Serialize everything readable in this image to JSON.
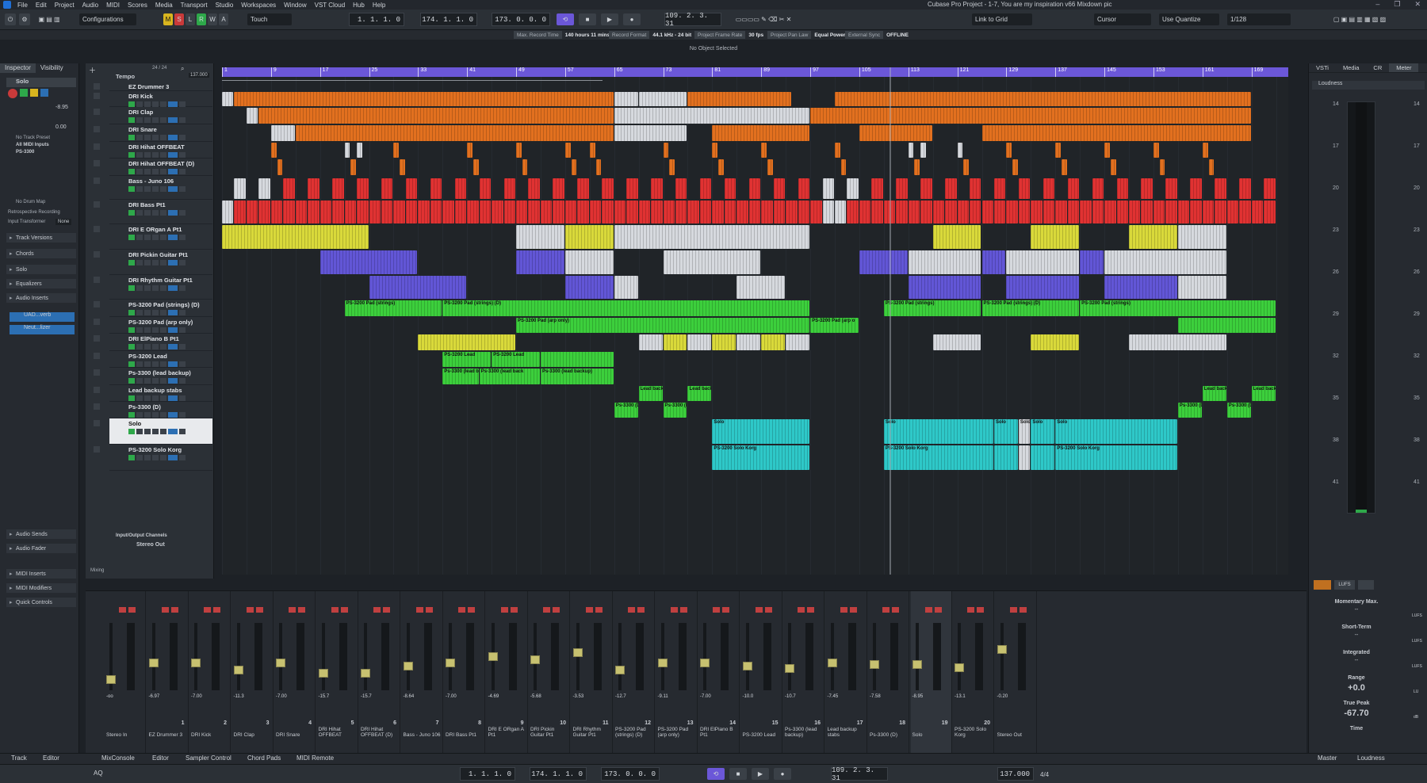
{
  "window": {
    "title": "Cubase Pro Project - 1-7, You are my inspiration v66 Mixdown pic",
    "menu": [
      "File",
      "Edit",
      "Project",
      "Audio",
      "MIDI",
      "Scores",
      "Media",
      "Transport",
      "Studio",
      "Workspaces",
      "Window",
      "VST Cloud",
      "Hub",
      "Help"
    ]
  },
  "toolbar": {
    "configurations": "Configurations",
    "mode_m": "M",
    "mode_s": "S",
    "mode_l": "L",
    "mode_r": "R",
    "mode_w": "W",
    "mode_a": "A",
    "automation_mode": "Touch",
    "left_locator": "1. 1. 1.  0",
    "right_locator": "174. 1. 1.  0",
    "punch_pos": "173.  0.  0.  0",
    "position": "109. 2. 3. 31",
    "snap": "Link to Grid",
    "cursor": "Cursor",
    "quantize": "Use Quantize",
    "quantize_value": "1/128"
  },
  "status_line": [
    {
      "label": "Max. Record Time",
      "value": "140 hours 11 mins"
    },
    {
      "label": "Record Format",
      "value": "44.1 kHz - 24 bit"
    },
    {
      "label": "Project Frame Rate",
      "value": "30 fps"
    },
    {
      "label": "Project Pan Law",
      "value": "Equal Power"
    },
    {
      "label": "External Sync",
      "value": "OFFLINE"
    }
  ],
  "info_line": "No Object Selected",
  "inspector": {
    "tabs": [
      "Inspector",
      "Visibility"
    ],
    "track_name": "Solo",
    "volume": "-8.95",
    "pan": "0.00",
    "no_track_preset": "No Track Preset",
    "input": "All MIDI Inputs",
    "output": "PS-3300",
    "no_drum_map": "No Drum Map",
    "retro": "Retrospective Recording",
    "input_transformer": "Input Transformer",
    "input_transformer_value": "None",
    "sections": [
      "Track Versions",
      "Chords",
      "Solo",
      "Equalizers",
      "Audio Inserts",
      "Audio Sends",
      "Audio Fader",
      "MIDI Inserts",
      "MIDI Modifiers",
      "Quick Controls"
    ],
    "inserts": [
      "UAD...verb",
      "Neut...lizer"
    ]
  },
  "tracklist": {
    "count": "24 / 24",
    "tempo_label": "Tempo",
    "tempo_value": "137.000",
    "tracks": [
      "EZ Drummer 3",
      "DRI Kick",
      "DRI Clap",
      "DRI Snare",
      "DRI Hihat OFFBEAT",
      "DRI Hihat OFFBEAT (D)",
      "Bass - Juno 106",
      "DRI Bass Pt1",
      "DRI E ORgan A Pt1",
      "DRI Pickin Guitar Pt1",
      "DRI Rhythm Guitar Pt1",
      "PS-3200 Pad (strings) (D)",
      "PS-3200 Pad (arp only)",
      "DRI ElPiano B Pt1",
      "PS-3200 Lead",
      "Ps-3300 (lead backup)",
      "Lead backup stabs",
      "Ps-3300 (D)",
      "Solo",
      "PS-3200 Solo Korg"
    ],
    "folder": "Input/Output Channels",
    "stereo_out": "Stereo Out",
    "mixing": "Mixing"
  },
  "ruler": [
    "1",
    "9",
    "17",
    "25",
    "33",
    "41",
    "49",
    "57",
    "65",
    "73",
    "81",
    "89",
    "97",
    "105",
    "113",
    "121",
    "129",
    "137",
    "145",
    "153",
    "161",
    "169"
  ],
  "clip_labels": {
    "pad1": "PS-3200 Pad (strings)",
    "pad2": "PS-3200 Pad (strings) (D)",
    "pad3": "PS-3200 Pad (strings)",
    "arp1": "PS-3200 Pad (arp only)",
    "arp2": "PS-3200 Pad (arp o",
    "lead": "PS-3200 Lead",
    "leadbk": "Ps-3300 (lead backup)",
    "leadbk2": "Ps-3300 (lead back",
    "stabs": "Lead backu",
    "ps3300d": "Ps-3300 (D)",
    "solo": "Solo",
    "korg": "PS-3200 Solo Korg"
  },
  "right_zone": {
    "tabs": [
      "VSTi",
      "Media",
      "CR",
      "Meter"
    ],
    "section": "Loudness",
    "scale": [
      "14",
      "17",
      "20",
      "23",
      "26",
      "29",
      "32",
      "35",
      "38",
      "41"
    ],
    "lufs_button": "LUFS",
    "momentary": "Momentary Max.",
    "short_term": "Short-Term",
    "integrated": "Integrated",
    "range_label": "Range",
    "range_value": "+0.0",
    "true_peak_label": "True Peak",
    "true_peak_value": "-67.70",
    "time_label": "Time",
    "unit_lufs": "LUFS",
    "unit_lu": "LU",
    "unit_db": "dB",
    "dash": "--"
  },
  "mixer": {
    "channels": [
      {
        "name": "Stereo In",
        "num": "",
        "db": "-oo"
      },
      {
        "name": "EZ Drummer 3",
        "num": "1",
        "db": "-6.97"
      },
      {
        "name": "DRI Kick",
        "num": "2",
        "db": "-7.00"
      },
      {
        "name": "DRI Clap",
        "num": "3",
        "db": "-11.3"
      },
      {
        "name": "DRI Snare",
        "num": "4",
        "db": "-7.00"
      },
      {
        "name": "DRI Hihat OFFBEAT",
        "num": "5",
        "db": "-15.7"
      },
      {
        "name": "DRI Hihat OFFBEAT (D)",
        "num": "6",
        "db": "-15.7"
      },
      {
        "name": "Bass - Juno 106",
        "num": "7",
        "db": "-8.64"
      },
      {
        "name": "DRI Bass Pt1",
        "num": "8",
        "db": "-7.00"
      },
      {
        "name": "DRI E ORgan A Pt1",
        "num": "9",
        "db": "-4.69"
      },
      {
        "name": "DRI Pickin Guitar Pt1",
        "num": "10",
        "db": "-5.68"
      },
      {
        "name": "DRI Rhythm Guitar Pt1",
        "num": "11",
        "db": "-3.53"
      },
      {
        "name": "PS-3200 Pad (strings) (D)",
        "num": "12",
        "db": "-12.7"
      },
      {
        "name": "PS-3200 Pad (arp only)",
        "num": "13",
        "db": "-9.11"
      },
      {
        "name": "DRI ElPiano B Pt1",
        "num": "14",
        "db": "-7.00"
      },
      {
        "name": "PS-3200 Lead",
        "num": "15",
        "db": "-10.0"
      },
      {
        "name": "Ps-3300 (lead backup)",
        "num": "16",
        "db": "-10.7"
      },
      {
        "name": "Lead backup stabs",
        "num": "17",
        "db": "-7.45"
      },
      {
        "name": "Ps-3300 (D)",
        "num": "18",
        "db": "-7.58"
      },
      {
        "name": "Solo",
        "num": "19",
        "db": "-8.95"
      },
      {
        "name": "PS-3200 Solo Korg",
        "num": "20",
        "db": "-13.1"
      },
      {
        "name": "Stereo Out",
        "num": "",
        "db": "-0.20"
      }
    ]
  },
  "lower_tabs": {
    "left": [
      "Track",
      "Editor"
    ],
    "center": [
      "MixConsole",
      "Editor",
      "Sampler Control",
      "Chord Pads",
      "MIDI Remote"
    ],
    "right": [
      "Master",
      "Loudness"
    ]
  },
  "transport": {
    "left": "1. 1. 1.  0",
    "right": "174. 1. 1.  0",
    "punch": "173.  0.  0.  0",
    "position": "109. 2. 3. 31",
    "tempo": "137.000",
    "signature": "4/4",
    "aq": "AQ"
  },
  "colors": {
    "ruler": "#6b57d8",
    "drums": "#e2701f",
    "bass": "#e03232",
    "organ": "#d9d93a",
    "guitar": "#6256d6",
    "pad": "#3ccf3c",
    "solo": "#2ec8c8",
    "muted": "#d6d9de"
  }
}
